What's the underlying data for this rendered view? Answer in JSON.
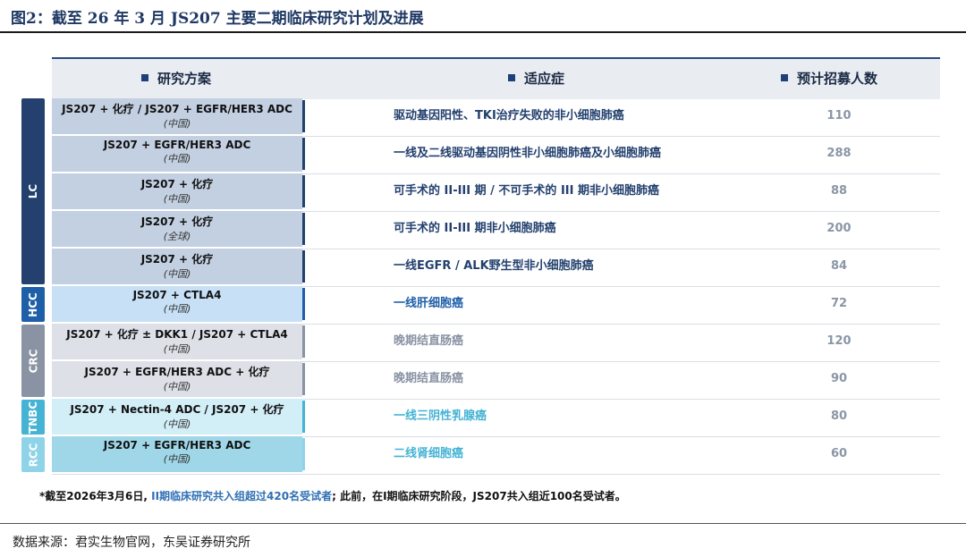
{
  "figure_title": "图2：截至 26 年 3 月 JS207 主要二期临床研究计划及进展",
  "header": {
    "col1": "研究方案",
    "col2": "适应症",
    "col3": "预计招募人数",
    "bullet_color": "#1f3f7a"
  },
  "groups": [
    {
      "label": "LC",
      "color": "#23406e"
    },
    {
      "label": "HCC",
      "color": "#1f5fa8"
    },
    {
      "label": "CRC",
      "color": "#8993a3"
    },
    {
      "label": "TNBC",
      "color": "#45b3d4"
    },
    {
      "label": "RCC",
      "color": "#8fd3e8"
    }
  ],
  "rows": [
    {
      "scheme": "JS207 + 化疗 / JS207 + EGFR/HER3 ADC",
      "region": "(中国)",
      "indication": "驱动基因阳性、TKI治疗失败的非小细胞肺癌",
      "enroll": "110"
    },
    {
      "scheme": "JS207 + EGFR/HER3 ADC",
      "region": "(中国)",
      "indication": "一线及二线驱动基因阴性非小细胞肺癌及小细胞肺癌",
      "enroll": "288"
    },
    {
      "scheme": "JS207 + 化疗",
      "region": "(中国)",
      "indication": "可手术的 II-III 期 / 不可手术的 III 期非小细胞肺癌",
      "enroll": "88"
    },
    {
      "scheme": "JS207 + 化疗",
      "region": "(全球)",
      "indication": "可手术的 II-III 期非小细胞肺癌",
      "enroll": "200"
    },
    {
      "scheme": "JS207 + 化疗",
      "region": "(中国)",
      "indication": "一线EGFR / ALK野生型非小细胞肺癌",
      "enroll": "84"
    },
    {
      "scheme": "JS207 + CTLA4",
      "region": "(中国)",
      "indication": "一线肝细胞癌",
      "enroll": "72"
    },
    {
      "scheme": "JS207 + 化疗 ± DKK1 / JS207 + CTLA4",
      "region": "(中国)",
      "indication": "晚期结直肠癌",
      "enroll": "120"
    },
    {
      "scheme": "JS207 + EGFR/HER3 ADC + 化疗",
      "region": "(中国)",
      "indication": "晚期结直肠癌",
      "enroll": "90"
    },
    {
      "scheme": "JS207 + Nectin-4 ADC / JS207 + 化疗",
      "region": "(中国)",
      "indication": "一线三阴性乳腺癌",
      "enroll": "80"
    },
    {
      "scheme": "JS207 + EGFR/HER3 ADC",
      "region": "(中国)",
      "indication": "二线肾细胞癌",
      "enroll": "60"
    }
  ],
  "footnote": {
    "part1": "*截至2026年3月6日, ",
    "highlight": "II期临床研究共入组超过420名受试者",
    "part2": "; 此前，在I期临床研究阶段，JS207共入组近100名受试者。"
  },
  "source": "数据来源：君实生物官网，东吴证券研究所"
}
